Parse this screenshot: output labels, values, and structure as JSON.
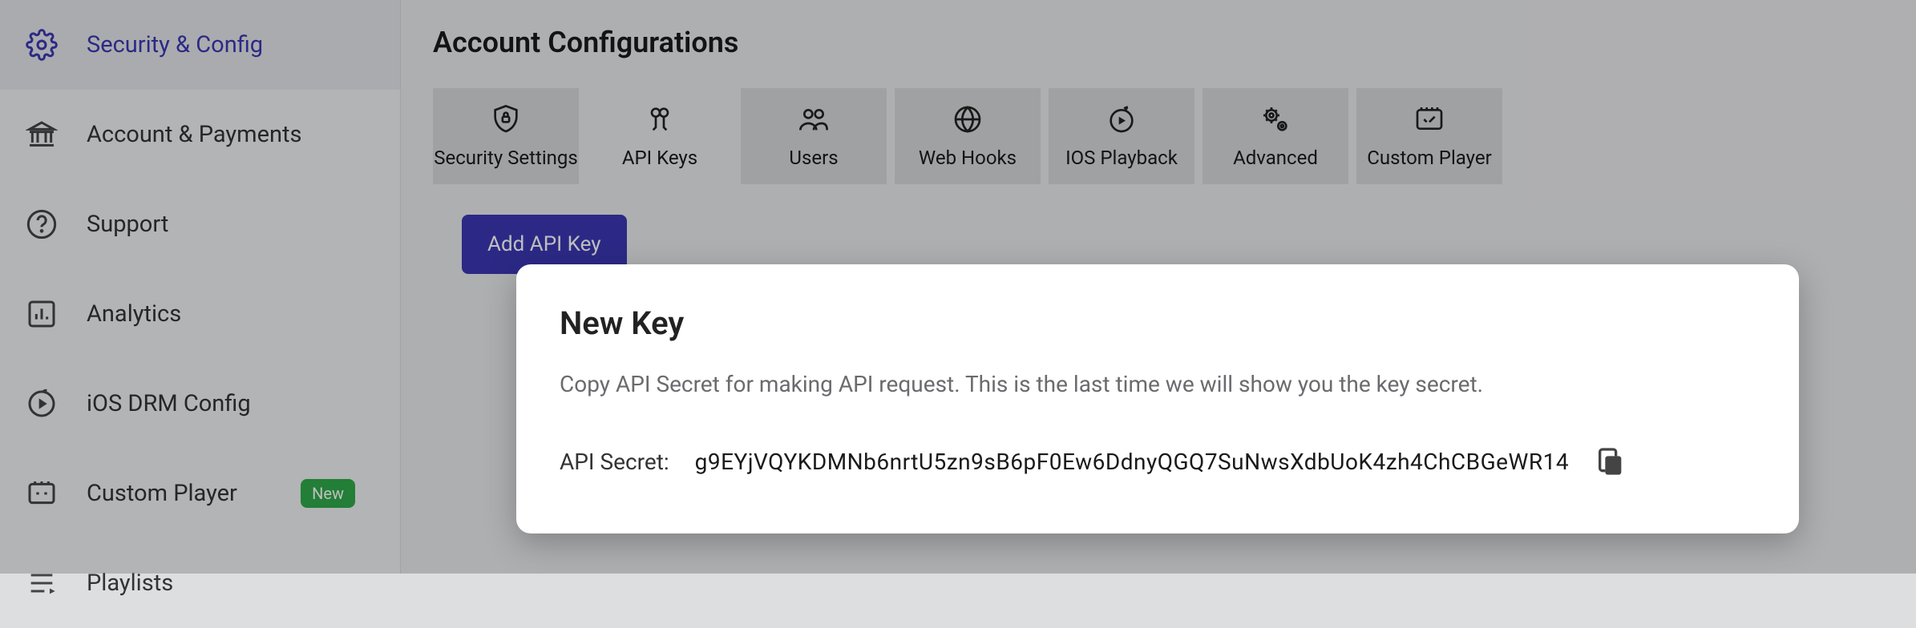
{
  "sidebar": {
    "items": [
      {
        "label": "Security & Config",
        "icon": "gear-icon",
        "active": true
      },
      {
        "label": "Account & Payments",
        "icon": "bank-icon"
      },
      {
        "label": "Support",
        "icon": "help-icon"
      },
      {
        "label": "Analytics",
        "icon": "chart-icon"
      },
      {
        "label": "iOS DRM Config",
        "icon": "apple-drm-icon"
      },
      {
        "label": "Custom Player",
        "icon": "player-icon",
        "badge": "New"
      },
      {
        "label": "Playlists",
        "icon": "playlist-icon"
      }
    ]
  },
  "main": {
    "title": "Account Configurations",
    "tabs": [
      {
        "label": "Security Settings",
        "icon": "shield-lock-icon"
      },
      {
        "label": "API Keys",
        "icon": "key-icon",
        "active": true
      },
      {
        "label": "Users",
        "icon": "users-icon"
      },
      {
        "label": "Web Hooks",
        "icon": "globe-icon"
      },
      {
        "label": "IOS Playback",
        "icon": "apple-play-icon"
      },
      {
        "label": "Advanced",
        "icon": "gears-icon"
      },
      {
        "label": "Custom Player",
        "icon": "custom-player-icon"
      }
    ],
    "add_button": "Add API Key"
  },
  "modal": {
    "title": "New Key",
    "description": "Copy API Secret for making API request. This is the last time we will show you the key secret.",
    "secret_label": "API Secret:",
    "secret_value": "g9EYjVQYKDMNb6nrtU5zn9sB6pF0Ew6DdnyQGQ7SuNwsXdbUoK4zh4ChCBGeWR14"
  },
  "colors": {
    "accent": "#3B37B3",
    "badge": "#2FA84A"
  }
}
